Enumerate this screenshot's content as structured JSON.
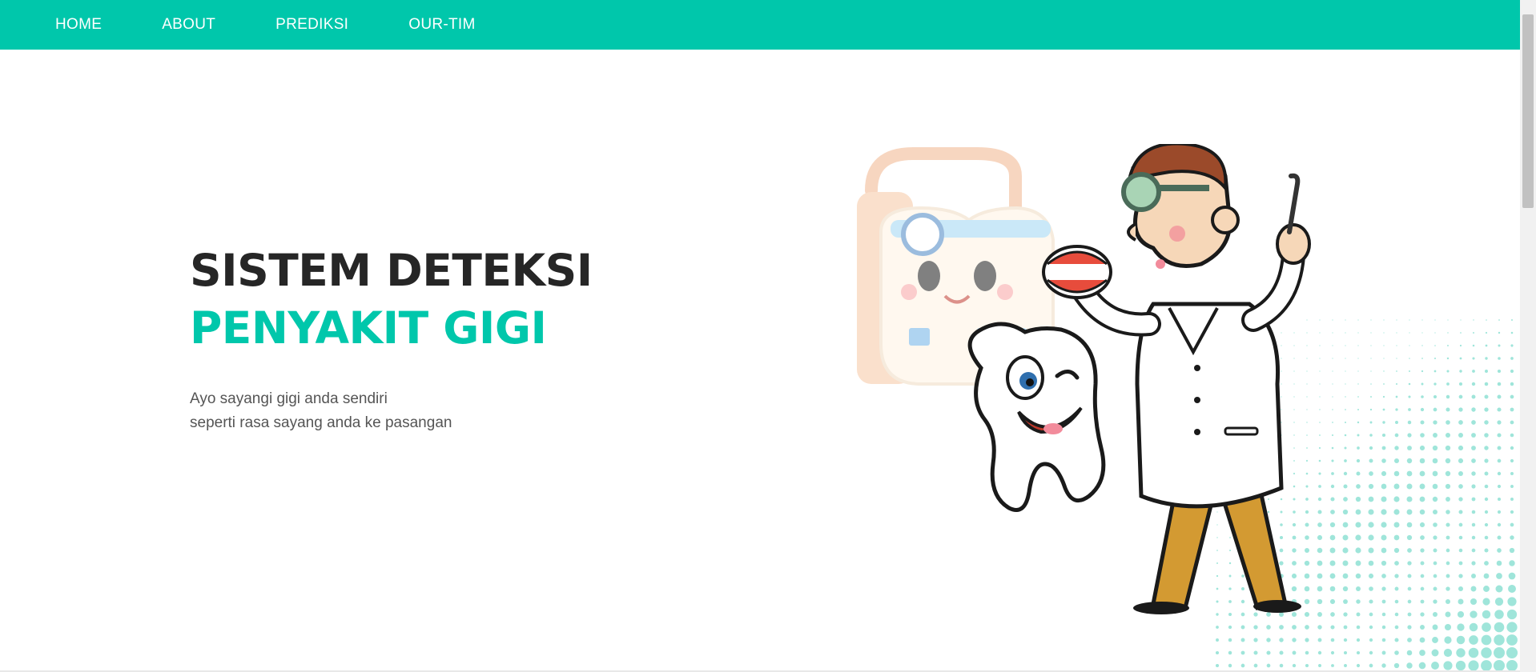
{
  "nav": {
    "items": [
      {
        "label": "HOME"
      },
      {
        "label": "ABOUT"
      },
      {
        "label": "PREDIKSI"
      },
      {
        "label": "OUR-TIM"
      }
    ]
  },
  "hero": {
    "title_line1": "SISTEM DETEKSI",
    "title_line2": "PENYAKIT GIGI",
    "desc_line1": "Ayo sayangi gigi anda sendiri",
    "desc_line2": "seperti rasa sayang anda ke pasangan"
  },
  "colors": {
    "accent": "#00c7ab",
    "title_dark": "#262626",
    "text_muted": "#555555"
  },
  "illustration": {
    "icons": [
      "tooth-dentist-icon",
      "dentist-character-icon",
      "smiling-tooth-icon",
      "dot-pattern-icon"
    ]
  }
}
